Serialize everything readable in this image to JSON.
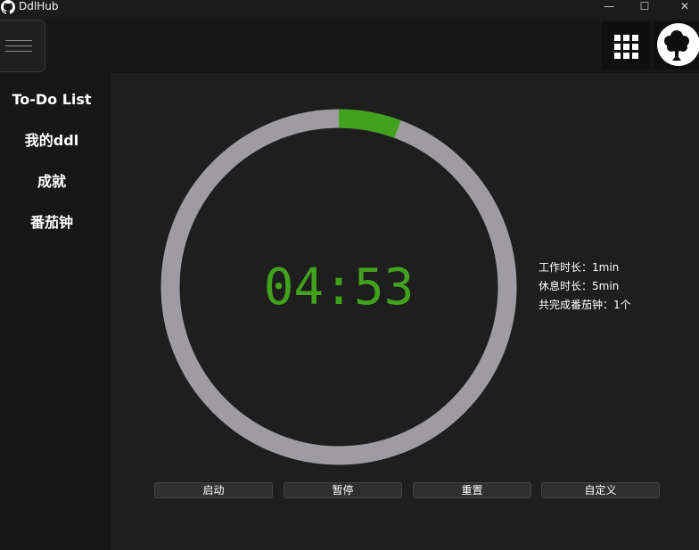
{
  "window": {
    "title": "DdlHub",
    "minimize_glyph": "—",
    "maximize_glyph": "☐",
    "close_glyph": "✕"
  },
  "colors": {
    "accent": "#41a21e",
    "ring": "#9e9ca1",
    "background": "#1e1e1e",
    "sidebar": "#171717"
  },
  "header": {
    "menu_icon": "hamburger-icon",
    "apps_icon": "grid-icon",
    "avatar_icon": "tree-avatar-icon"
  },
  "sidebar": {
    "items": [
      {
        "label": "To-Do List"
      },
      {
        "label": "我的ddl"
      },
      {
        "label": "成就"
      },
      {
        "label": "番茄钟"
      }
    ]
  },
  "timer": {
    "display": "04:53",
    "progress": 0.0567
  },
  "info": {
    "work_duration": "工作时长：1min",
    "rest_duration": "休息时长：5min",
    "completed_count": "共完成番茄钟：1个"
  },
  "controls": {
    "start_label": "启动",
    "pause_label": "暂停",
    "reset_label": "重置",
    "custom_label": "自定义"
  }
}
